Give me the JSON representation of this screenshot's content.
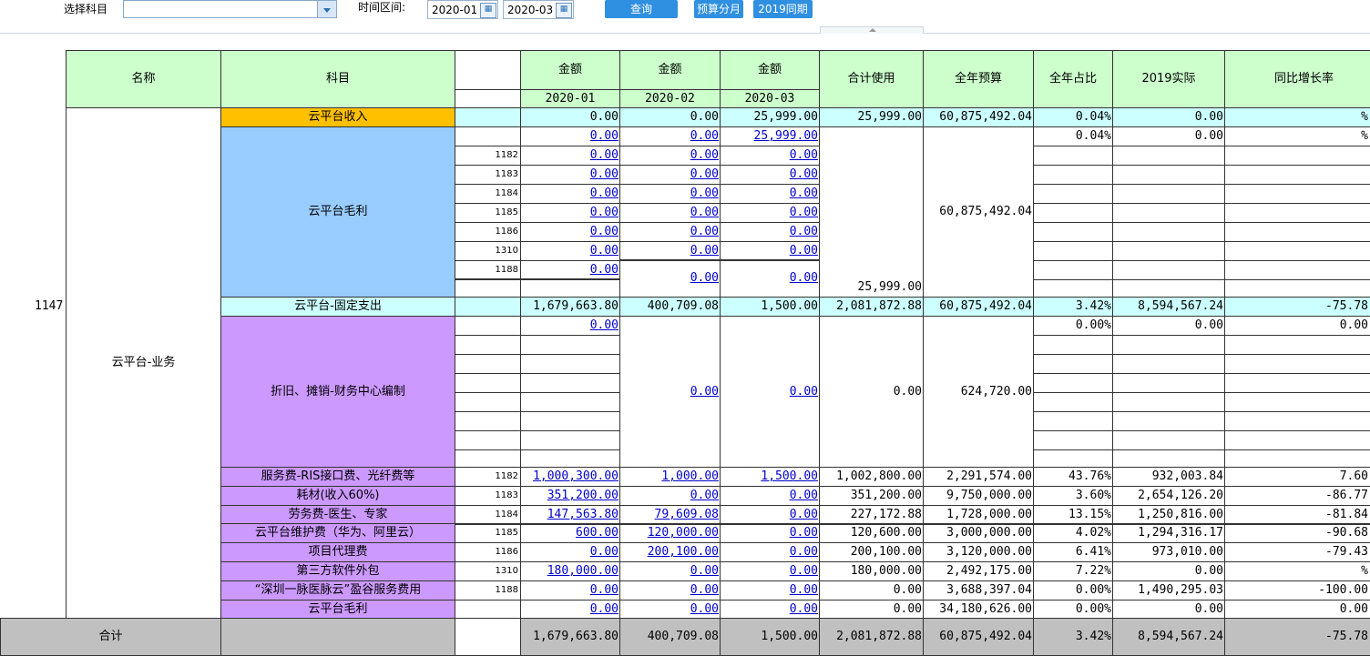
{
  "toolbar": {
    "subject_label": "选择科目",
    "subject_value": "",
    "period_label": "时间区间:",
    "date_start": "2020-01",
    "date_end": "2020-03",
    "query_button": "查询",
    "budget_button": "预算分月",
    "compare_button": "2019同期"
  },
  "table": {
    "headers": {
      "name": "名称",
      "subject": "科目",
      "amount": "金额",
      "months": [
        "2020-01",
        "2020-02",
        "2020-03"
      ],
      "total_used": "合计使用",
      "annual_budget": "全年预算",
      "annual_ratio": "全年占比",
      "actual_2019": "2019实际",
      "yoy_growth": "同比增长率"
    },
    "row_number": "1147",
    "group_name": "云平台-业务",
    "income_row": {
      "label": "云平台收入",
      "m1": "0.00",
      "m2": "0.00",
      "m3": "25,999.00",
      "total": "25,999.00",
      "budget": "60,875,492.04",
      "ratio": "0.04%",
      "actual": "0.00",
      "growth": "%"
    },
    "gross_block": {
      "label": "云平台毛利",
      "first": {
        "m1": "0.00",
        "m2": "0.00",
        "m3": "25,999.00",
        "ratio": "0.04%",
        "actual": "0.00",
        "growth": "%"
      },
      "codes": [
        "1182",
        "1183",
        "1184",
        "1185",
        "1186",
        "1310",
        "1188"
      ],
      "values": [
        "0.00",
        "0.00",
        "0.00",
        "0.00",
        "0.00",
        "0.00",
        "0.00"
      ],
      "m2_last": "0.00",
      "m3_last": "0.00",
      "total": "25,999.00",
      "budget": "60,875,492.04"
    },
    "fixed_row": {
      "label": "云平台-固定支出",
      "m1": "1,679,663.80",
      "m2": "400,709.08",
      "m3": "1,500.00",
      "total": "2,081,872.88",
      "budget": "60,875,492.04",
      "ratio": "3.42%",
      "actual": "8,594,567.24",
      "growth": "-75.78"
    },
    "depr_block": {
      "label": "折旧、摊销-财务中心编制",
      "m1": "0.00",
      "m2": "0.00",
      "m3": "0.00",
      "total": "0.00",
      "budget": "624,720.00",
      "ratio": "0.00%",
      "actual": "0.00",
      "growth": "0.00"
    },
    "items": [
      {
        "label": "服务费-RIS接口费、光纤费等",
        "code": "1182",
        "m1": "1,000,300.00",
        "m2": "1,000.00",
        "m3": "1,500.00",
        "total": "1,002,800.00",
        "budget": "2,291,574.00",
        "ratio": "43.76%",
        "actual": "932,003.84",
        "growth": "7.60"
      },
      {
        "label": "耗材(收入60%)",
        "code": "1183",
        "m1": "351,200.00",
        "m2": "0.00",
        "m3": "0.00",
        "total": "351,200.00",
        "budget": "9,750,000.00",
        "ratio": "3.60%",
        "actual": "2,654,126.20",
        "growth": "-86.77"
      },
      {
        "label": "劳务费-医生、专家",
        "code": "1184",
        "m1": "147,563.80",
        "m2": "79,609.08",
        "m3": "0.00",
        "total": "227,172.88",
        "budget": "1,728,000.00",
        "ratio": "13.15%",
        "actual": "1,250,816.00",
        "growth": "-81.84"
      },
      {
        "label": "云平台维护费（华为、阿里云）",
        "code": "1185",
        "m1": "600.00",
        "m2": "120,000.00",
        "m3": "0.00",
        "total": "120,600.00",
        "budget": "3,000,000.00",
        "ratio": "4.02%",
        "actual": "1,294,316.17",
        "growth": "-90.68"
      },
      {
        "label": "项目代理费",
        "code": "1186",
        "m1": "0.00",
        "m2": "200,100.00",
        "m3": "0.00",
        "total": "200,100.00",
        "budget": "3,120,000.00",
        "ratio": "6.41%",
        "actual": "973,010.00",
        "growth": "-79.43"
      },
      {
        "label": "第三方软件外包",
        "code": "1310",
        "m1": "180,000.00",
        "m2": "0.00",
        "m3": "0.00",
        "total": "180,000.00",
        "budget": "2,492,175.00",
        "ratio": "7.22%",
        "actual": "0.00",
        "growth": "%"
      },
      {
        "label": "“深圳一脉医脉云”盈谷服务费用",
        "code": "1188",
        "m1": "0.00",
        "m2": "0.00",
        "m3": "0.00",
        "total": "0.00",
        "budget": "3,688,397.04",
        "ratio": "0.00%",
        "actual": "1,490,295.03",
        "growth": "-100.00"
      },
      {
        "label": "云平台毛利",
        "code": "",
        "m1": "0.00",
        "m2": "0.00",
        "m3": "0.00",
        "total": "0.00",
        "budget": "34,180,626.00",
        "ratio": "0.00%",
        "actual": "0.00",
        "growth": "0.00"
      }
    ],
    "total_row": {
      "label": "合计",
      "m1": "1,679,663.80",
      "m2": "400,709.08",
      "m3": "1,500.00",
      "total": "2,081,872.88",
      "budget": "60,875,492.04",
      "ratio": "3.42%",
      "actual": "8,594,567.24",
      "growth": "-75.78"
    }
  }
}
